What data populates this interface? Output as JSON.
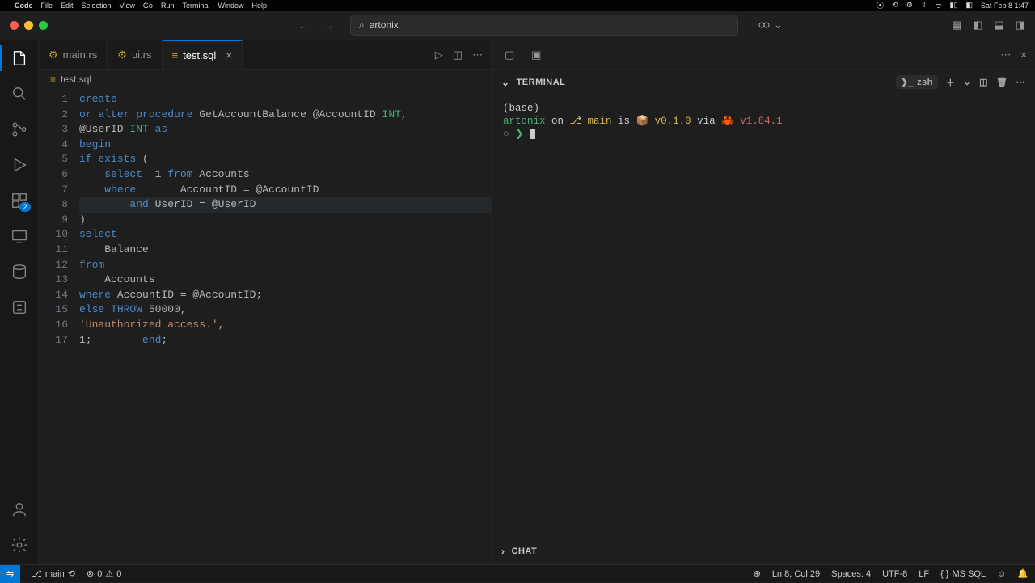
{
  "mac": {
    "app": "Code",
    "menus": [
      "File",
      "Edit",
      "Selection",
      "View",
      "Go",
      "Run",
      "Terminal",
      "Window",
      "Help"
    ],
    "clock": "Sat Feb 8  1:47"
  },
  "titlebar": {
    "search_text": "artonix"
  },
  "tabs": [
    {
      "label": "main.rs",
      "icon": "rust",
      "active": false
    },
    {
      "label": "ui.rs",
      "icon": "rust",
      "active": false
    },
    {
      "label": "test.sql",
      "icon": "sql",
      "active": true
    }
  ],
  "breadcrumb": "test.sql",
  "code_lines": [
    [
      {
        "t": "create",
        "c": "kw"
      }
    ],
    [
      {
        "t": "or",
        "c": "kw"
      },
      {
        "t": " "
      },
      {
        "t": "alter",
        "c": "kw"
      },
      {
        "t": " "
      },
      {
        "t": "procedure",
        "c": "kw"
      },
      {
        "t": " GetAccountBalance @AccountID "
      },
      {
        "t": "INT",
        "c": "ty"
      },
      {
        "t": ","
      }
    ],
    [
      {
        "t": "@UserID "
      },
      {
        "t": "INT",
        "c": "ty"
      },
      {
        "t": " "
      },
      {
        "t": "as",
        "c": "kw"
      }
    ],
    [
      {
        "t": "begin",
        "c": "kw"
      }
    ],
    [
      {
        "t": "if",
        "c": "kw"
      },
      {
        "t": " "
      },
      {
        "t": "exists",
        "c": "kw"
      },
      {
        "t": " ("
      }
    ],
    [
      {
        "t": "    "
      },
      {
        "t": "select",
        "c": "kw"
      },
      {
        "t": "  1 "
      },
      {
        "t": "from",
        "c": "kw"
      },
      {
        "t": " Accounts"
      }
    ],
    [
      {
        "t": "    "
      },
      {
        "t": "where",
        "c": "kw"
      },
      {
        "t": "       AccountID = @AccountID"
      }
    ],
    [
      {
        "t": "        "
      },
      {
        "t": "and",
        "c": "kw"
      },
      {
        "t": " UserID = @UserID"
      }
    ],
    [
      {
        "t": ")"
      }
    ],
    [
      {
        "t": "select",
        "c": "kw"
      }
    ],
    [
      {
        "t": "    Balance"
      }
    ],
    [
      {
        "t": "from",
        "c": "kw"
      }
    ],
    [
      {
        "t": "    Accounts"
      }
    ],
    [
      {
        "t": "where",
        "c": "kw"
      },
      {
        "t": " AccountID = @AccountID;"
      }
    ],
    [
      {
        "t": "else",
        "c": "kw"
      },
      {
        "t": " "
      },
      {
        "t": "THROW",
        "c": "kw"
      },
      {
        "t": " 50000,"
      }
    ],
    [
      {
        "t": "'Unauthorized access.'",
        "c": "str"
      },
      {
        "t": ","
      }
    ],
    [
      {
        "t": "1;        "
      },
      {
        "t": "end",
        "c": "kw"
      },
      {
        "t": ";"
      }
    ]
  ],
  "active_line": 8,
  "terminal": {
    "title": "TERMINAL",
    "shell": "zsh",
    "lines": {
      "base": "(base)",
      "proj": "artonix",
      "on": "on",
      "branch": "main",
      "is": "is",
      "pkgver": "v0.1.0",
      "via": "via",
      "rustver": "v1.84.1"
    }
  },
  "chat_title": "CHAT",
  "status": {
    "branch": "main",
    "errors": "0",
    "warnings": "0",
    "line_col": "Ln 8, Col 29",
    "spaces": "Spaces: 4",
    "encoding": "UTF-8",
    "eol": "LF",
    "lang": "MS SQL"
  },
  "activity_badge": "2"
}
